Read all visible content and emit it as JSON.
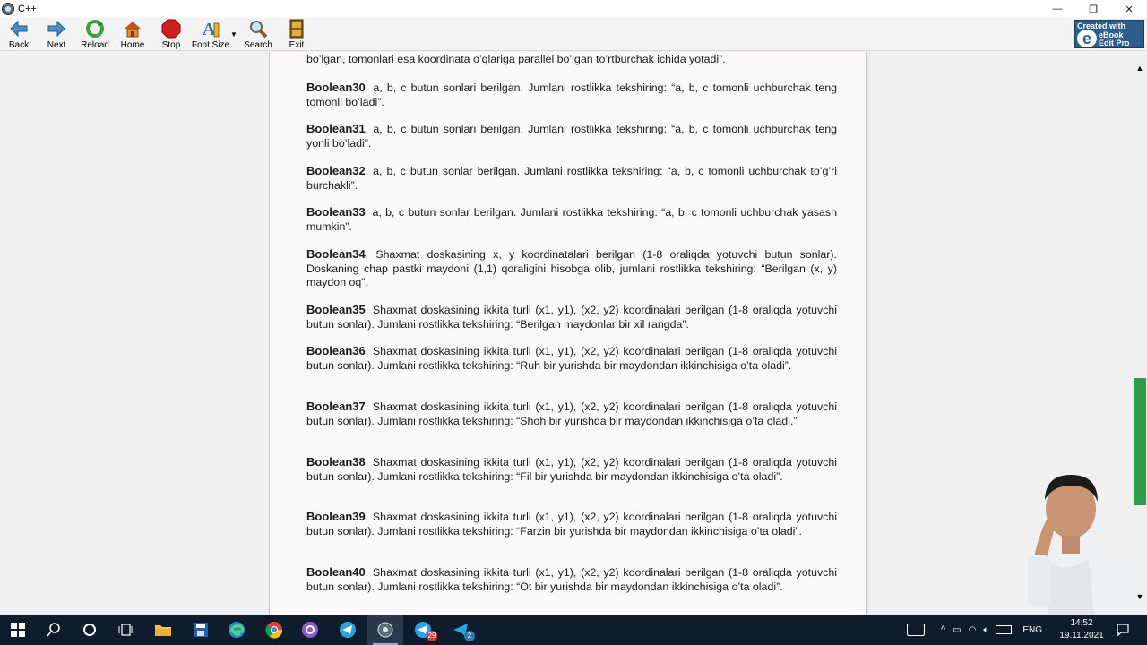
{
  "window": {
    "title": "C++",
    "controls": {
      "minimize": "—",
      "maximize": "❐",
      "close": "✕"
    }
  },
  "toolbar": {
    "buttons": [
      {
        "label": "Back",
        "icon": "back-arrow-icon"
      },
      {
        "label": "Next",
        "icon": "next-arrow-icon"
      },
      {
        "label": "Reload",
        "icon": "reload-icon"
      },
      {
        "label": "Home",
        "icon": "home-icon"
      },
      {
        "label": "Stop",
        "icon": "stop-icon"
      },
      {
        "label": "Font Size",
        "icon": "font-size-icon"
      },
      {
        "label": "Search",
        "icon": "magnifier-icon"
      },
      {
        "label": "Exit",
        "icon": "exit-door-icon"
      }
    ],
    "brand": {
      "line1": "Created with",
      "line2": "eBook",
      "line3": "Edit Pro",
      "letter": "e"
    }
  },
  "document": {
    "intro_tail": "bo’lgan, tomonlari esa koordinata o’qlariga parallel bo’lgan to’rtburchak ichida yotadi”.",
    "items": [
      {
        "name": "Boolean30",
        "text": ". a, b, c butun sonlari berilgan. Jumlani rostlikka tekshiring: “a, b, c tomonli uchburchak teng tomonli bo’ladi”."
      },
      {
        "name": "Boolean31",
        "text": ". a, b, c butun sonlari berilgan. Jumlani rostlikka tekshiring: “a, b, c tomonli uchburchak teng yonli bo’ladi”."
      },
      {
        "name": "Boolean32",
        "text": ". a, b, c butun sonlar berilgan. Jumlani rostlikka tekshiring: “a, b, c tomonli uchburchak to’g’ri burchakli”."
      },
      {
        "name": "Boolean33",
        "text": ". a, b, c butun sonlar berilgan. Jumlani rostlikka tekshiring: “a, b, c tomonli uchburchak yasash mumkin”."
      },
      {
        "name": "Boolean34",
        "text": ". Shaxmat doskasining x, y koordinatalari berilgan (1-8 oraliqda yotuvchi butun sonlar). Doskaning chap pastki maydoni (1,1) qoraligini hisobga olib, jumlani rostlikka tekshiring: “Berilgan (x, y) maydon oq”."
      },
      {
        "name": "Boolean35",
        "text": ". Shaxmat doskasining ikkita turli (x1, y1), (x2, y2) koordinalari berilgan (1-8 oraliqda yotuvchi butun sonlar). Jumlani rostlikka tekshiring: “Berilgan maydonlar bir xil rangda”."
      },
      {
        "name": "Boolean36",
        "text": ". Shaxmat doskasining ikkita turli (x1, y1), (x2, y2) koordinalari berilgan (1-8 oraliqda yotuvchi butun sonlar). Jumlani rostlikka tekshiring: “Ruh bir yurishda bir maydondan ikkinchisiga o’ta oladi”."
      },
      {
        "name": "Boolean37",
        "text": ". Shaxmat doskasining ikkita turli (x1, y1), (x2, y2) koordinalari berilgan (1-8 oraliqda yotuvchi butun sonlar). Jumlani rostlikka tekshiring:  “Shoh bir yurishda bir maydondan ikkinchisiga o’ta oladi.”"
      },
      {
        "name": "Boolean38",
        "text": ". Shaxmat doskasining ikkita turli (x1, y1), (x2, y2) koordinalari berilgan (1-8 oraliqda yotuvchi butun sonlar). Jumlani rostlikka tekshiring:  “Fil bir  yurishda bir maydondan ikkinchisiga o’ta oladi”."
      },
      {
        "name": "Boolean39",
        "text": ". Shaxmat doskasining ikkita turli (x1, y1), (x2, y2) koordinalari berilgan (1-8 oraliqda yotuvchi butun sonlar). Jumlani rostlikka tekshiring:  “Farzin bir yurishda bir maydondan ikkinchisiga o’ta oladi”."
      },
      {
        "name": "Boolean40",
        "text": ". Shaxmat doskasining ikkita turli (x1, y1), (x2, y2) koordinalari berilgan (1-8 oraliqda yotuvchi butun sonlar). Jumlani rostlikka tekshiring:  “Ot bir  yurishda bir maydondan ikkinchisiga o’ta oladi”."
      }
    ]
  },
  "scrollbar": {
    "position_fraction": 0.55
  },
  "colors": {
    "accent": "#2e9e4a",
    "taskbar": "#0f1c2b",
    "page": "#fcf9fb"
  },
  "taskbar": {
    "apps": [
      {
        "name": "start-icon"
      },
      {
        "name": "search-icon"
      },
      {
        "name": "cortana-icon"
      },
      {
        "name": "task-view-icon"
      },
      {
        "name": "file-explorer-icon"
      },
      {
        "name": "save-app-icon"
      },
      {
        "name": "edge-icon"
      },
      {
        "name": "chrome-icon"
      },
      {
        "name": "github-icon"
      },
      {
        "name": "telegram-icon"
      },
      {
        "name": "ebook-app-icon"
      },
      {
        "name": "telegram-icon",
        "badge": "29"
      },
      {
        "name": "telegram-icon",
        "badge": "2"
      }
    ],
    "tray": {
      "language": "ENG",
      "time": "14:52",
      "date": "19.11.2021"
    }
  }
}
